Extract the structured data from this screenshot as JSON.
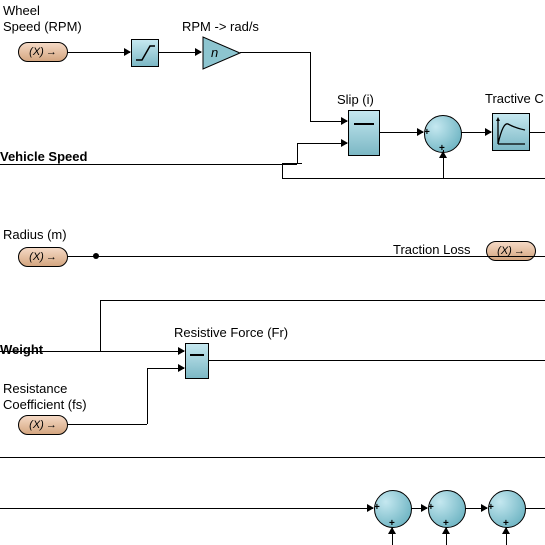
{
  "labels": {
    "wheel_speed1": "Wheel",
    "wheel_speed2": "Speed (RPM)",
    "rpm_rads": "RPM -> rad/s",
    "slip": "Slip (i)",
    "tractive": "Tractive C",
    "vehicle_speed": "Vehicle Speed",
    "radius": "Radius (m)",
    "traction_loss": "Traction Loss",
    "weight": "Weight",
    "resistive_force": "Resistive Force (Fr)",
    "resistance1": "Resistance",
    "resistance2": "Coefficient (fs)"
  },
  "input_label": "(X)",
  "gain_letter": "n"
}
